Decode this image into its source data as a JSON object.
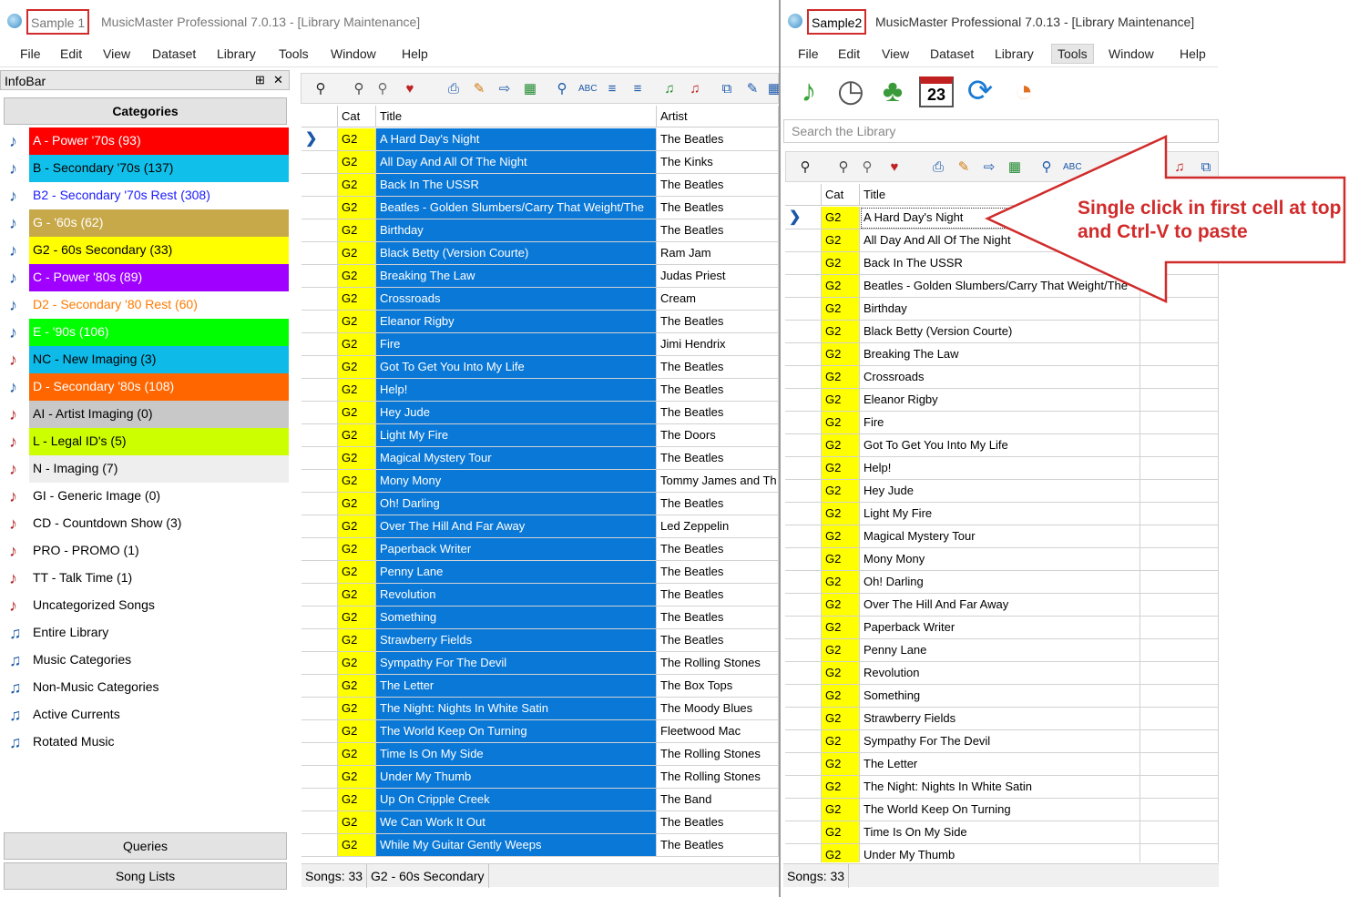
{
  "window1": {
    "sample": "Sample 1",
    "title": "MusicMaster Professional 7.0.13 - [Library Maintenance]"
  },
  "window2": {
    "sample": "Sample2",
    "title": "MusicMaster Professional 7.0.13 - [Library Maintenance]"
  },
  "menu1": [
    "File",
    "Edit",
    "View",
    "Dataset",
    "Library",
    "Tools",
    "Window",
    "Help"
  ],
  "menu2": [
    "File",
    "Edit",
    "View",
    "Dataset",
    "Library",
    "Tools",
    "Window",
    "Help"
  ],
  "infobar": {
    "title": "InfoBar",
    "pin": "⊞",
    "close": "✕",
    "categories_label": "Categories",
    "queries_label": "Queries",
    "songlists_label": "Song Lists"
  },
  "categories": [
    {
      "label": "A - Power '70s  (93)",
      "bg": "#ff0000",
      "fg": "#ffffff",
      "icon": "music-note-icon"
    },
    {
      "label": "B - Secondary '70s  (137)",
      "bg": "#11c0ea",
      "fg": "#000000",
      "icon": "music-note-icon"
    },
    {
      "label": "B2 - Secondary '70s Rest  (308)",
      "bg": "#ffffff",
      "fg": "#1a1aff",
      "icon": "music-note-icon"
    },
    {
      "label": "G - '60s  (62)",
      "bg": "#c8a94a",
      "fg": "#ffffff",
      "icon": "music-note-icon"
    },
    {
      "label": "G2 - 60s Secondary  (33)",
      "bg": "#ffff00",
      "fg": "#000000",
      "icon": "music-note-icon"
    },
    {
      "label": "C - Power '80s  (89)",
      "bg": "#a000ff",
      "fg": "#ffffff",
      "icon": "music-note-icon"
    },
    {
      "label": "D2 - Secondary '80 Rest  (60)",
      "bg": "#ffffff",
      "fg": "#ff7a00",
      "icon": "music-note-icon"
    },
    {
      "label": "E - '90s  (106)",
      "bg": "#00ff00",
      "fg": "#ffffff",
      "icon": "music-note-icon"
    },
    {
      "label": "NC - New Imaging  (3)",
      "bg": "#0ebae8",
      "fg": "#000000",
      "icon": "imaging-note-icon"
    },
    {
      "label": "D - Secondary '80s  (108)",
      "bg": "#ff6600",
      "fg": "#ffffff",
      "icon": "music-note-icon"
    },
    {
      "label": "AI - Artist Imaging  (0)",
      "bg": "#c8c8c8",
      "fg": "#000000",
      "icon": "imaging-note-icon"
    },
    {
      "label": "L - Legal ID's  (5)",
      "bg": "#ccff00",
      "fg": "#000000",
      "icon": "imaging-note-icon"
    },
    {
      "label": "N - Imaging  (7)",
      "bg": "#eeeeee",
      "fg": "#000000",
      "icon": "imaging-note-icon"
    },
    {
      "label": "GI - Generic Image  (0)",
      "bg": "#ffffff",
      "fg": "#000000",
      "icon": "imaging-note-icon"
    },
    {
      "label": "CD - Countdown Show  (3)",
      "bg": "#ffffff",
      "fg": "#000000",
      "icon": "imaging-note-icon"
    },
    {
      "label": "PRO - PROMO  (1)",
      "bg": "#ffffff",
      "fg": "#000000",
      "icon": "imaging-note-icon"
    },
    {
      "label": "TT - Talk Time  (1)",
      "bg": "#ffffff",
      "fg": "#000000",
      "icon": "imaging-note-icon"
    },
    {
      "label": "Uncategorized Songs",
      "bg": "#ffffff",
      "fg": "#000000",
      "icon": "uncategorized-icon"
    },
    {
      "label": "Entire Library",
      "bg": "#ffffff",
      "fg": "#000000",
      "icon": "double-note-icon"
    },
    {
      "label": "Music Categories",
      "bg": "#ffffff",
      "fg": "#000000",
      "icon": "double-note-icon"
    },
    {
      "label": "Non-Music Categories",
      "bg": "#ffffff",
      "fg": "#000000",
      "icon": "double-note-icon"
    },
    {
      "label": "Active Currents",
      "bg": "#ffffff",
      "fg": "#000000",
      "icon": "double-note-icon"
    },
    {
      "label": "Rotated Music",
      "bg": "#ffffff",
      "fg": "#000000",
      "icon": "double-note-icon"
    }
  ],
  "grid1": {
    "headers": {
      "cat": "Cat",
      "title": "Title",
      "artist": "Artist"
    },
    "rows": [
      {
        "cat": "G2",
        "title": "A Hard Day's Night",
        "artist": "The Beatles"
      },
      {
        "cat": "G2",
        "title": "All Day And All Of The Night",
        "artist": "The Kinks"
      },
      {
        "cat": "G2",
        "title": "Back In The USSR",
        "artist": "The Beatles"
      },
      {
        "cat": "G2",
        "title": "Beatles - Golden Slumbers/Carry That Weight/The",
        "artist": "The Beatles"
      },
      {
        "cat": "G2",
        "title": "Birthday",
        "artist": "The Beatles"
      },
      {
        "cat": "G2",
        "title": "Black Betty (Version Courte)",
        "artist": "Ram Jam"
      },
      {
        "cat": "G2",
        "title": "Breaking The Law",
        "artist": "Judas Priest"
      },
      {
        "cat": "G2",
        "title": "Crossroads",
        "artist": "Cream"
      },
      {
        "cat": "G2",
        "title": "Eleanor Rigby",
        "artist": "The Beatles"
      },
      {
        "cat": "G2",
        "title": "Fire",
        "artist": "Jimi Hendrix"
      },
      {
        "cat": "G2",
        "title": "Got To Get You Into My Life",
        "artist": "The Beatles"
      },
      {
        "cat": "G2",
        "title": "Help!",
        "artist": "The Beatles"
      },
      {
        "cat": "G2",
        "title": "Hey Jude",
        "artist": "The Beatles"
      },
      {
        "cat": "G2",
        "title": "Light My Fire",
        "artist": "The Doors"
      },
      {
        "cat": "G2",
        "title": "Magical Mystery Tour",
        "artist": "The Beatles"
      },
      {
        "cat": "G2",
        "title": "Mony Mony",
        "artist": "Tommy James and Th"
      },
      {
        "cat": "G2",
        "title": "Oh! Darling",
        "artist": "The Beatles"
      },
      {
        "cat": "G2",
        "title": "Over The Hill And Far Away",
        "artist": "Led Zeppelin"
      },
      {
        "cat": "G2",
        "title": "Paperback Writer",
        "artist": "The Beatles"
      },
      {
        "cat": "G2",
        "title": "Penny Lane",
        "artist": "The Beatles"
      },
      {
        "cat": "G2",
        "title": "Revolution",
        "artist": "The Beatles"
      },
      {
        "cat": "G2",
        "title": "Something",
        "artist": "The Beatles"
      },
      {
        "cat": "G2",
        "title": "Strawberry Fields",
        "artist": "The Beatles"
      },
      {
        "cat": "G2",
        "title": "Sympathy For The Devil",
        "artist": "The Rolling Stones"
      },
      {
        "cat": "G2",
        "title": "The Letter",
        "artist": "The Box Tops"
      },
      {
        "cat": "G2",
        "title": "The Night: Nights In White Satin",
        "artist": "The Moody Blues"
      },
      {
        "cat": "G2",
        "title": "The World Keep On Turning",
        "artist": "Fleetwood Mac"
      },
      {
        "cat": "G2",
        "title": "Time Is On My Side",
        "artist": "The Rolling Stones"
      },
      {
        "cat": "G2",
        "title": "Under My Thumb",
        "artist": "The Rolling Stones"
      },
      {
        "cat": "G2",
        "title": "Up On Cripple Creek",
        "artist": "The Band"
      },
      {
        "cat": "G2",
        "title": "We Can Work It Out",
        "artist": "The Beatles"
      },
      {
        "cat": "G2",
        "title": "While My Guitar Gently Weeps",
        "artist": "The Beatles"
      }
    ]
  },
  "grid2": {
    "headers": {
      "cat": "Cat",
      "title": "Title"
    },
    "rows": [
      {
        "cat": "G2",
        "title": "A Hard Day's Night"
      },
      {
        "cat": "G2",
        "title": "All Day And All Of The Night"
      },
      {
        "cat": "G2",
        "title": "Back In The USSR"
      },
      {
        "cat": "G2",
        "title": "Beatles - Golden Slumbers/Carry That Weight/The"
      },
      {
        "cat": "G2",
        "title": "Birthday"
      },
      {
        "cat": "G2",
        "title": "Black Betty (Version Courte)"
      },
      {
        "cat": "G2",
        "title": "Breaking The Law"
      },
      {
        "cat": "G2",
        "title": "Crossroads"
      },
      {
        "cat": "G2",
        "title": "Eleanor Rigby"
      },
      {
        "cat": "G2",
        "title": "Fire"
      },
      {
        "cat": "G2",
        "title": "Got To Get You Into My Life"
      },
      {
        "cat": "G2",
        "title": "Help!"
      },
      {
        "cat": "G2",
        "title": "Hey Jude"
      },
      {
        "cat": "G2",
        "title": "Light My Fire"
      },
      {
        "cat": "G2",
        "title": "Magical Mystery Tour"
      },
      {
        "cat": "G2",
        "title": "Mony Mony"
      },
      {
        "cat": "G2",
        "title": "Oh! Darling"
      },
      {
        "cat": "G2",
        "title": "Over The Hill And Far Away"
      },
      {
        "cat": "G2",
        "title": "Paperback Writer"
      },
      {
        "cat": "G2",
        "title": "Penny Lane"
      },
      {
        "cat": "G2",
        "title": "Revolution"
      },
      {
        "cat": "G2",
        "title": "Something"
      },
      {
        "cat": "G2",
        "title": "Strawberry Fields"
      },
      {
        "cat": "G2",
        "title": "Sympathy For The Devil"
      },
      {
        "cat": "G2",
        "title": "The Letter"
      },
      {
        "cat": "G2",
        "title": "The Night: Nights In White Satin"
      },
      {
        "cat": "G2",
        "title": "The World Keep On Turning"
      },
      {
        "cat": "G2",
        "title": "Time Is On My Side"
      },
      {
        "cat": "G2",
        "title": "Under My Thumb"
      }
    ]
  },
  "status1": {
    "songs": "Songs: 33",
    "category": "G2 - 60s Secondary"
  },
  "status2": {
    "songs": "Songs: 33"
  },
  "search": {
    "placeholder": "Search the Library"
  },
  "big_toolbar_day": "23",
  "callout": "Single click in first cell at top and Ctrl-V to paste",
  "colors": {
    "selected_title": "#0a78d7",
    "cat_cell": "#ffff00",
    "callout": "#d12b2b"
  }
}
